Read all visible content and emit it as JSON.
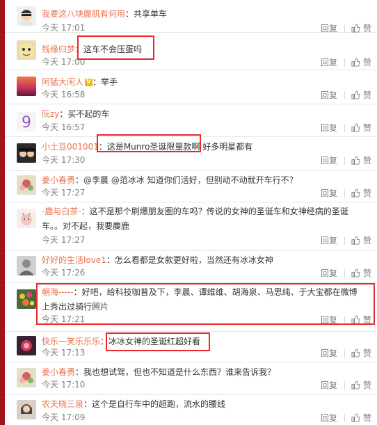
{
  "labels": {
    "reply": "回复",
    "like": "赞"
  },
  "comments": [
    {
      "user": "我要这八块腹肌有何用",
      "sep": "：",
      "text": "共享单车",
      "time": "今天 17:01"
    },
    {
      "user": "残缘归梦",
      "sep": "：",
      "text": "这车不会压蛋吗",
      "time": "今天 17:00"
    },
    {
      "user": "阿猛大闲人",
      "badge": "V",
      "sep": "：",
      "text": "举手",
      "time": "今天 16:58"
    },
    {
      "user": "阮zy",
      "sep": "：",
      "text": "买不起的车",
      "time": "今天 16:57"
    },
    {
      "user": "小土豆001001",
      "sep": "：",
      "text": "这是Munro圣诞限量款啊",
      "text2": " 好多明星都有",
      "time": "今天 17:30"
    },
    {
      "user": "姜小春勇",
      "sep": "：",
      "text": "@李晨 @范冰冰 知道你们活好，但别动不动就开车行不？",
      "time": "今天 17:27"
    },
    {
      "user": "-鹿与白茶-",
      "sep": "：",
      "text": "这不是那个刷爆朋友圈的车吗？传说的女神的圣诞车和女神经病的圣诞车。。对不起，我要麋鹿",
      "time": "今天 17:27"
    },
    {
      "user": "好好的生活love1",
      "sep": "：",
      "text": "怎么看都是女款更好啦，当然还有冰冰女神",
      "time": "今天 17:26"
    },
    {
      "user": "朝海-----",
      "sep": "：",
      "text": "好吧，给科技咖普及下，李晨、谭维维、胡海泉、马思纯、于大宝都在微博上秀出过骑行照片",
      "time": "今天 17:21"
    },
    {
      "user": "快乐一笑乐乐乐",
      "sep": "：",
      "text": "冰冰女神的圣诞红超好看",
      "time": "今天 17:13"
    },
    {
      "user": "姜小春勇",
      "sep": "：",
      "text": "我也想试驾，但也不知道是什么东西？谁来告诉我？",
      "time": "今天 17:10"
    },
    {
      "user": "农夫晓三泉",
      "sep": "：",
      "text": "这个是自行车中的超跑，流水的腰线",
      "time": "今天 17:09"
    }
  ]
}
